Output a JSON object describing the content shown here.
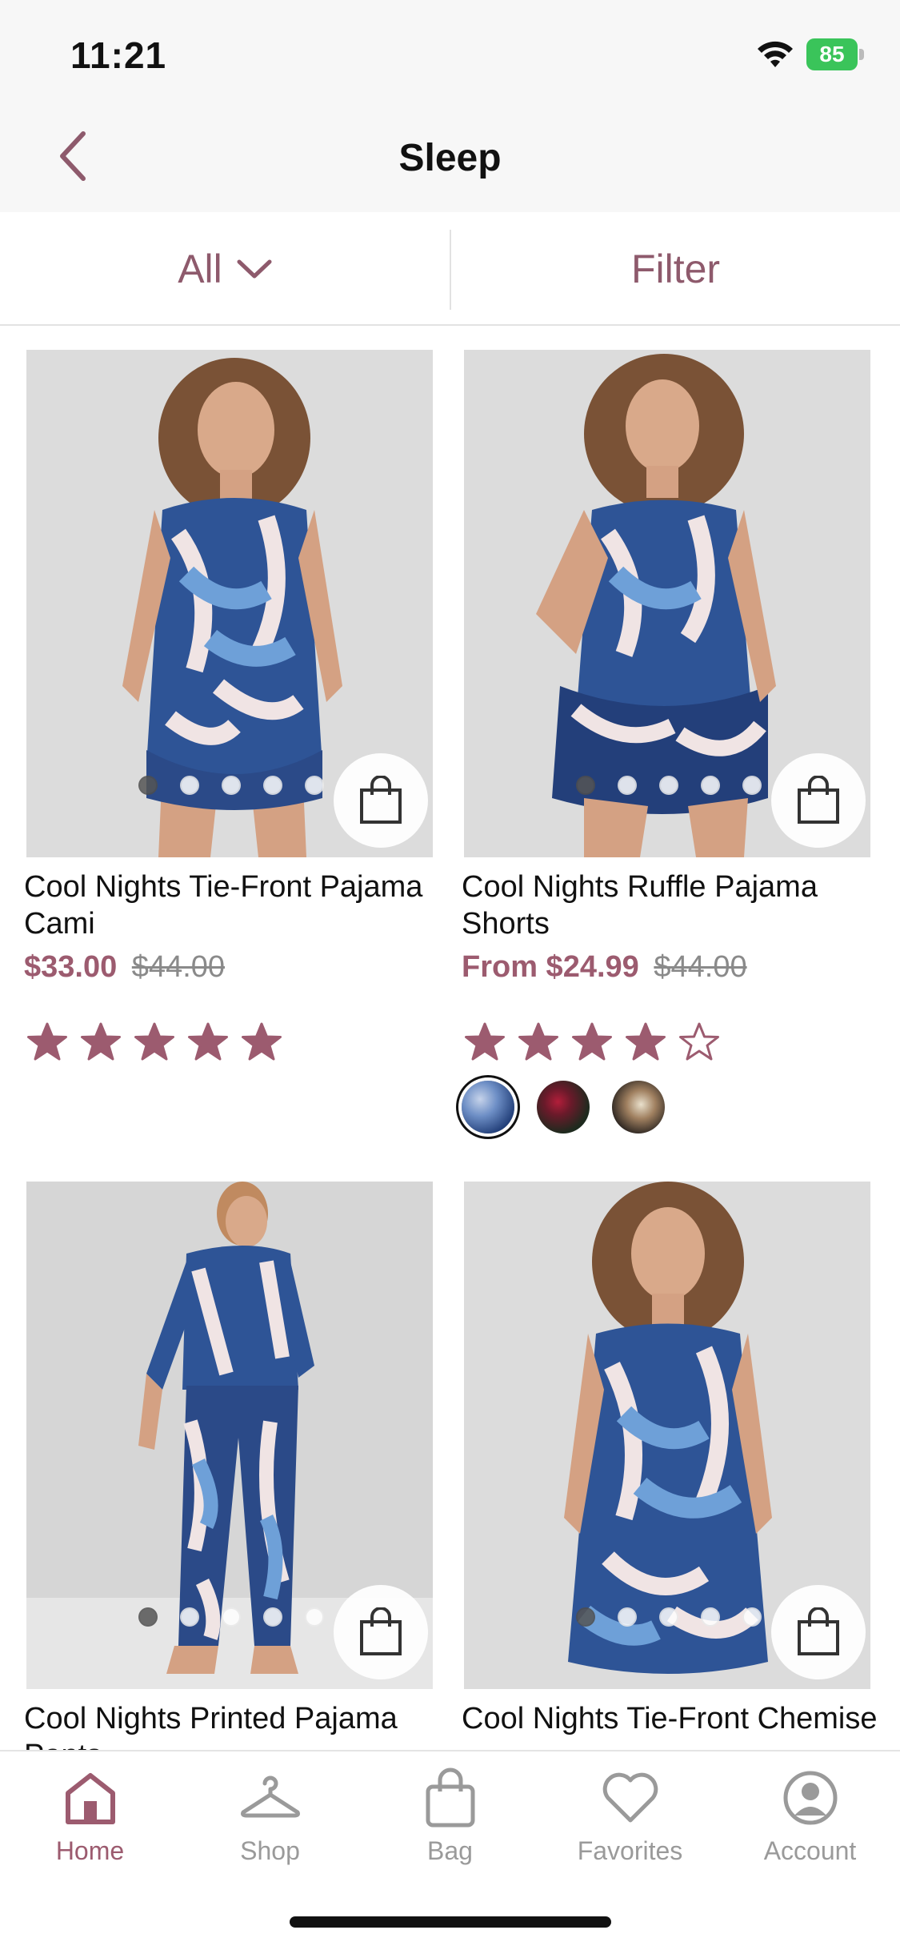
{
  "status_bar": {
    "time": "11:21",
    "battery": "85"
  },
  "nav": {
    "title": "Sleep"
  },
  "filters": {
    "all_label": "All",
    "filter_label": "Filter"
  },
  "products": [
    {
      "name": "Cool Nights Tie-Front Pajama Cami",
      "price": "$33.00",
      "original_price": "$44.00",
      "rating": 5,
      "image_count": 5,
      "active_image": 0
    },
    {
      "name": "Cool Nights Ruffle Pajama Shorts",
      "price": "From $24.99",
      "original_price": "$44.00",
      "rating": 4,
      "image_count": 5,
      "active_image": 0,
      "swatches": [
        {
          "name": "blue-print",
          "color": "#3f62a3",
          "selected": true
        },
        {
          "name": "dark-floral",
          "color": "#2a2a2a",
          "selected": false
        },
        {
          "name": "brown-print",
          "color": "#4a3a30",
          "selected": false
        }
      ]
    },
    {
      "name": "Cool Nights Printed Pajama Pants",
      "image_count": 5,
      "active_image": 0
    },
    {
      "name": "Cool Nights Tie-Front Chemise",
      "image_count": 5,
      "active_image": 0
    }
  ],
  "tab_bar": {
    "tabs": [
      {
        "label": "Home",
        "icon": "home-icon",
        "active": true
      },
      {
        "label": "Shop",
        "icon": "hanger-icon",
        "active": false
      },
      {
        "label": "Bag",
        "icon": "bag-icon",
        "active": false
      },
      {
        "label": "Favorites",
        "icon": "heart-icon",
        "active": false
      },
      {
        "label": "Account",
        "icon": "account-icon",
        "active": false
      }
    ]
  },
  "colors": {
    "accent": "#9c5b6f",
    "filter_text": "#8e5a6c",
    "inactive_tab": "#9a9a9a"
  }
}
